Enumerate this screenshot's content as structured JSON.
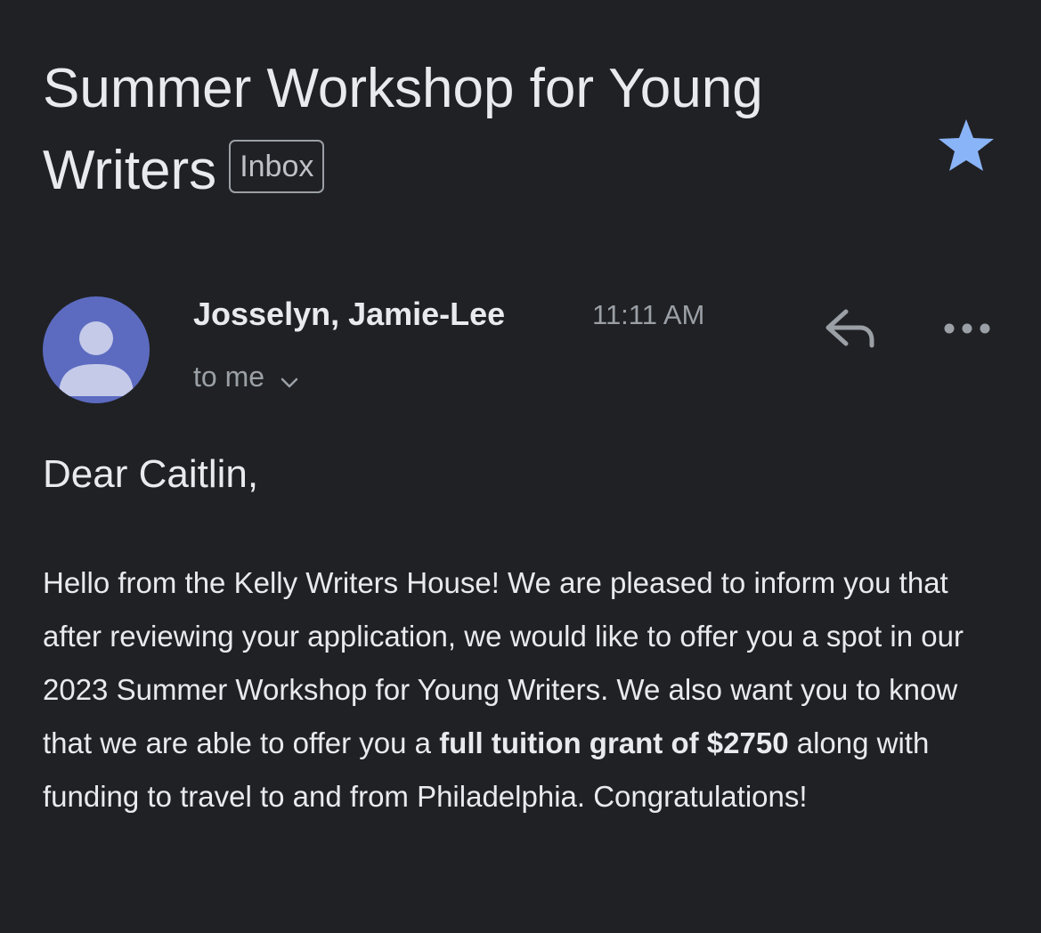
{
  "email": {
    "subject": "Summer Workshop for Young Writers",
    "label": "Inbox",
    "starred": true,
    "sender": "Josselyn, Jamie-Lee",
    "time": "11:11 AM",
    "recipients": "to me",
    "greeting": "Dear Caitlin,",
    "body": {
      "part1": "Hello from the Kelly Writers House! We are pleased to inform you that after reviewing your application, we would like to offer you a spot in our 2023 Summer Workshop for Young Writers. We also want you to know that we are able to offer you a ",
      "bold": "full tuition grant of $2750",
      "part2": " along with funding to travel to and from Philadelphia. Congratulations!"
    }
  },
  "icons": {
    "star": "star-icon",
    "avatar": "person-icon",
    "reply": "reply-icon",
    "more": "more-horizontal-icon",
    "expand": "chevron-down-icon"
  },
  "colors": {
    "background": "#202124",
    "star": "#8ab4f8",
    "avatar": "#5c6bc0",
    "avatar_figure": "#c5cae9"
  }
}
